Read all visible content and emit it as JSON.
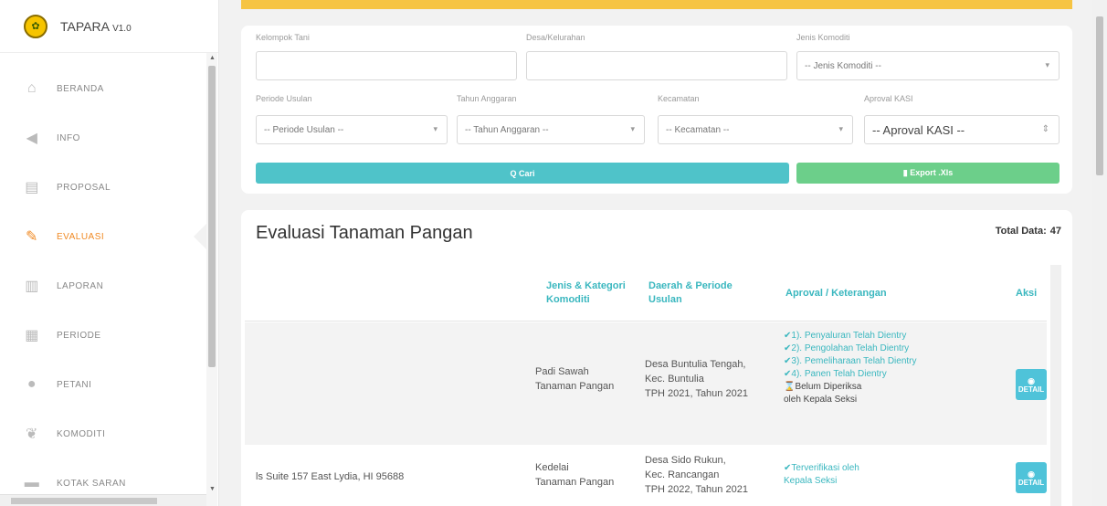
{
  "brand": {
    "name": "TAPARA",
    "version": "V1.0"
  },
  "menu": [
    {
      "label": "BERANDA",
      "icon": "home-icon",
      "glyph": "⌂"
    },
    {
      "label": "INFO",
      "icon": "megaphone-icon",
      "glyph": "◀"
    },
    {
      "label": "PROPOSAL",
      "icon": "document-icon",
      "glyph": "▤"
    },
    {
      "label": "EVALUASI",
      "icon": "edit-document-icon",
      "glyph": "✎"
    },
    {
      "label": "LAPORAN",
      "icon": "bar-chart-icon",
      "glyph": "▥"
    },
    {
      "label": "PERIODE",
      "icon": "calendar-icon",
      "glyph": "▦"
    },
    {
      "label": "PETANI",
      "icon": "users-icon",
      "glyph": "●"
    },
    {
      "label": "KOMODITI",
      "icon": "sprout-icon",
      "glyph": "❦"
    },
    {
      "label": "KOTAK SARAN",
      "icon": "inbox-icon",
      "glyph": "▬"
    }
  ],
  "active_menu": "EVALUASI",
  "filters": {
    "kelompok_tani": {
      "label": "Kelompok Tani",
      "value": ""
    },
    "desa": {
      "label": "Desa/Kelurahan",
      "value": ""
    },
    "jenis_komoditi": {
      "label": "Jenis Komoditi",
      "value": "-- Jenis Komoditi --"
    },
    "periode_usulan": {
      "label": "Periode Usulan",
      "value": "-- Periode Usulan --"
    },
    "tahun_anggaran": {
      "label": "Tahun Anggaran",
      "value": "-- Tahun Anggaran --"
    },
    "kecamatan": {
      "label": "Kecamatan",
      "value": "-- Kecamatan --"
    },
    "aproval_kasi": {
      "label": "Aproval KASI",
      "value": "-- Aproval KASI --"
    }
  },
  "buttons": {
    "cari": "Q Cari",
    "export": "▮ Export .Xls"
  },
  "table": {
    "title": "Evaluasi Tanaman Pangan",
    "total_label": "Total Data:",
    "total_value": "47",
    "headers": {
      "jenis_line1": "Jenis & Kategori",
      "jenis_line2": "Komoditi",
      "daerah_line1": "Daerah & Periode",
      "daerah_line2": "Usulan",
      "aproval": "Aproval / Keterangan",
      "aksi": "Aksi"
    },
    "rows": [
      {
        "name": "",
        "jenis": "Padi Sawah",
        "kategori": "Tanaman Pangan",
        "desa": "Desa Buntulia Tengah,",
        "kec": "Kec. Buntulia",
        "periode": "TPH 2021, Tahun 2021",
        "status": [
          "✔1). Penyaluran Telah Dientry",
          "✔2). Pengolahan Telah Dientry",
          "✔3). Pemeliharaan Telah Dientry",
          "✔4). Panen Telah Dientry"
        ],
        "note_line1": "⌛Belum Diperiksa",
        "note_line2": "oleh Kepala Seksi",
        "action": "DETAIL"
      },
      {
        "name": "ls Suite 157 East Lydia, HI 95688",
        "jenis": "Kedelai",
        "kategori": "Tanaman Pangan",
        "desa": "Desa Sido Rukun,",
        "kec": "Kec. Rancangan",
        "periode": "TPH 2022, Tahun 2021",
        "verified_line1": "✔Terverifikasi oleh",
        "verified_line2": "Kepala Seksi",
        "action": "DETAIL"
      }
    ]
  },
  "colors": {
    "accent": "#f08a24",
    "teal": "#3ab7bf",
    "cari": "#4fc3c9",
    "export": "#6ccf8a",
    "topbar": "#f6c443"
  }
}
